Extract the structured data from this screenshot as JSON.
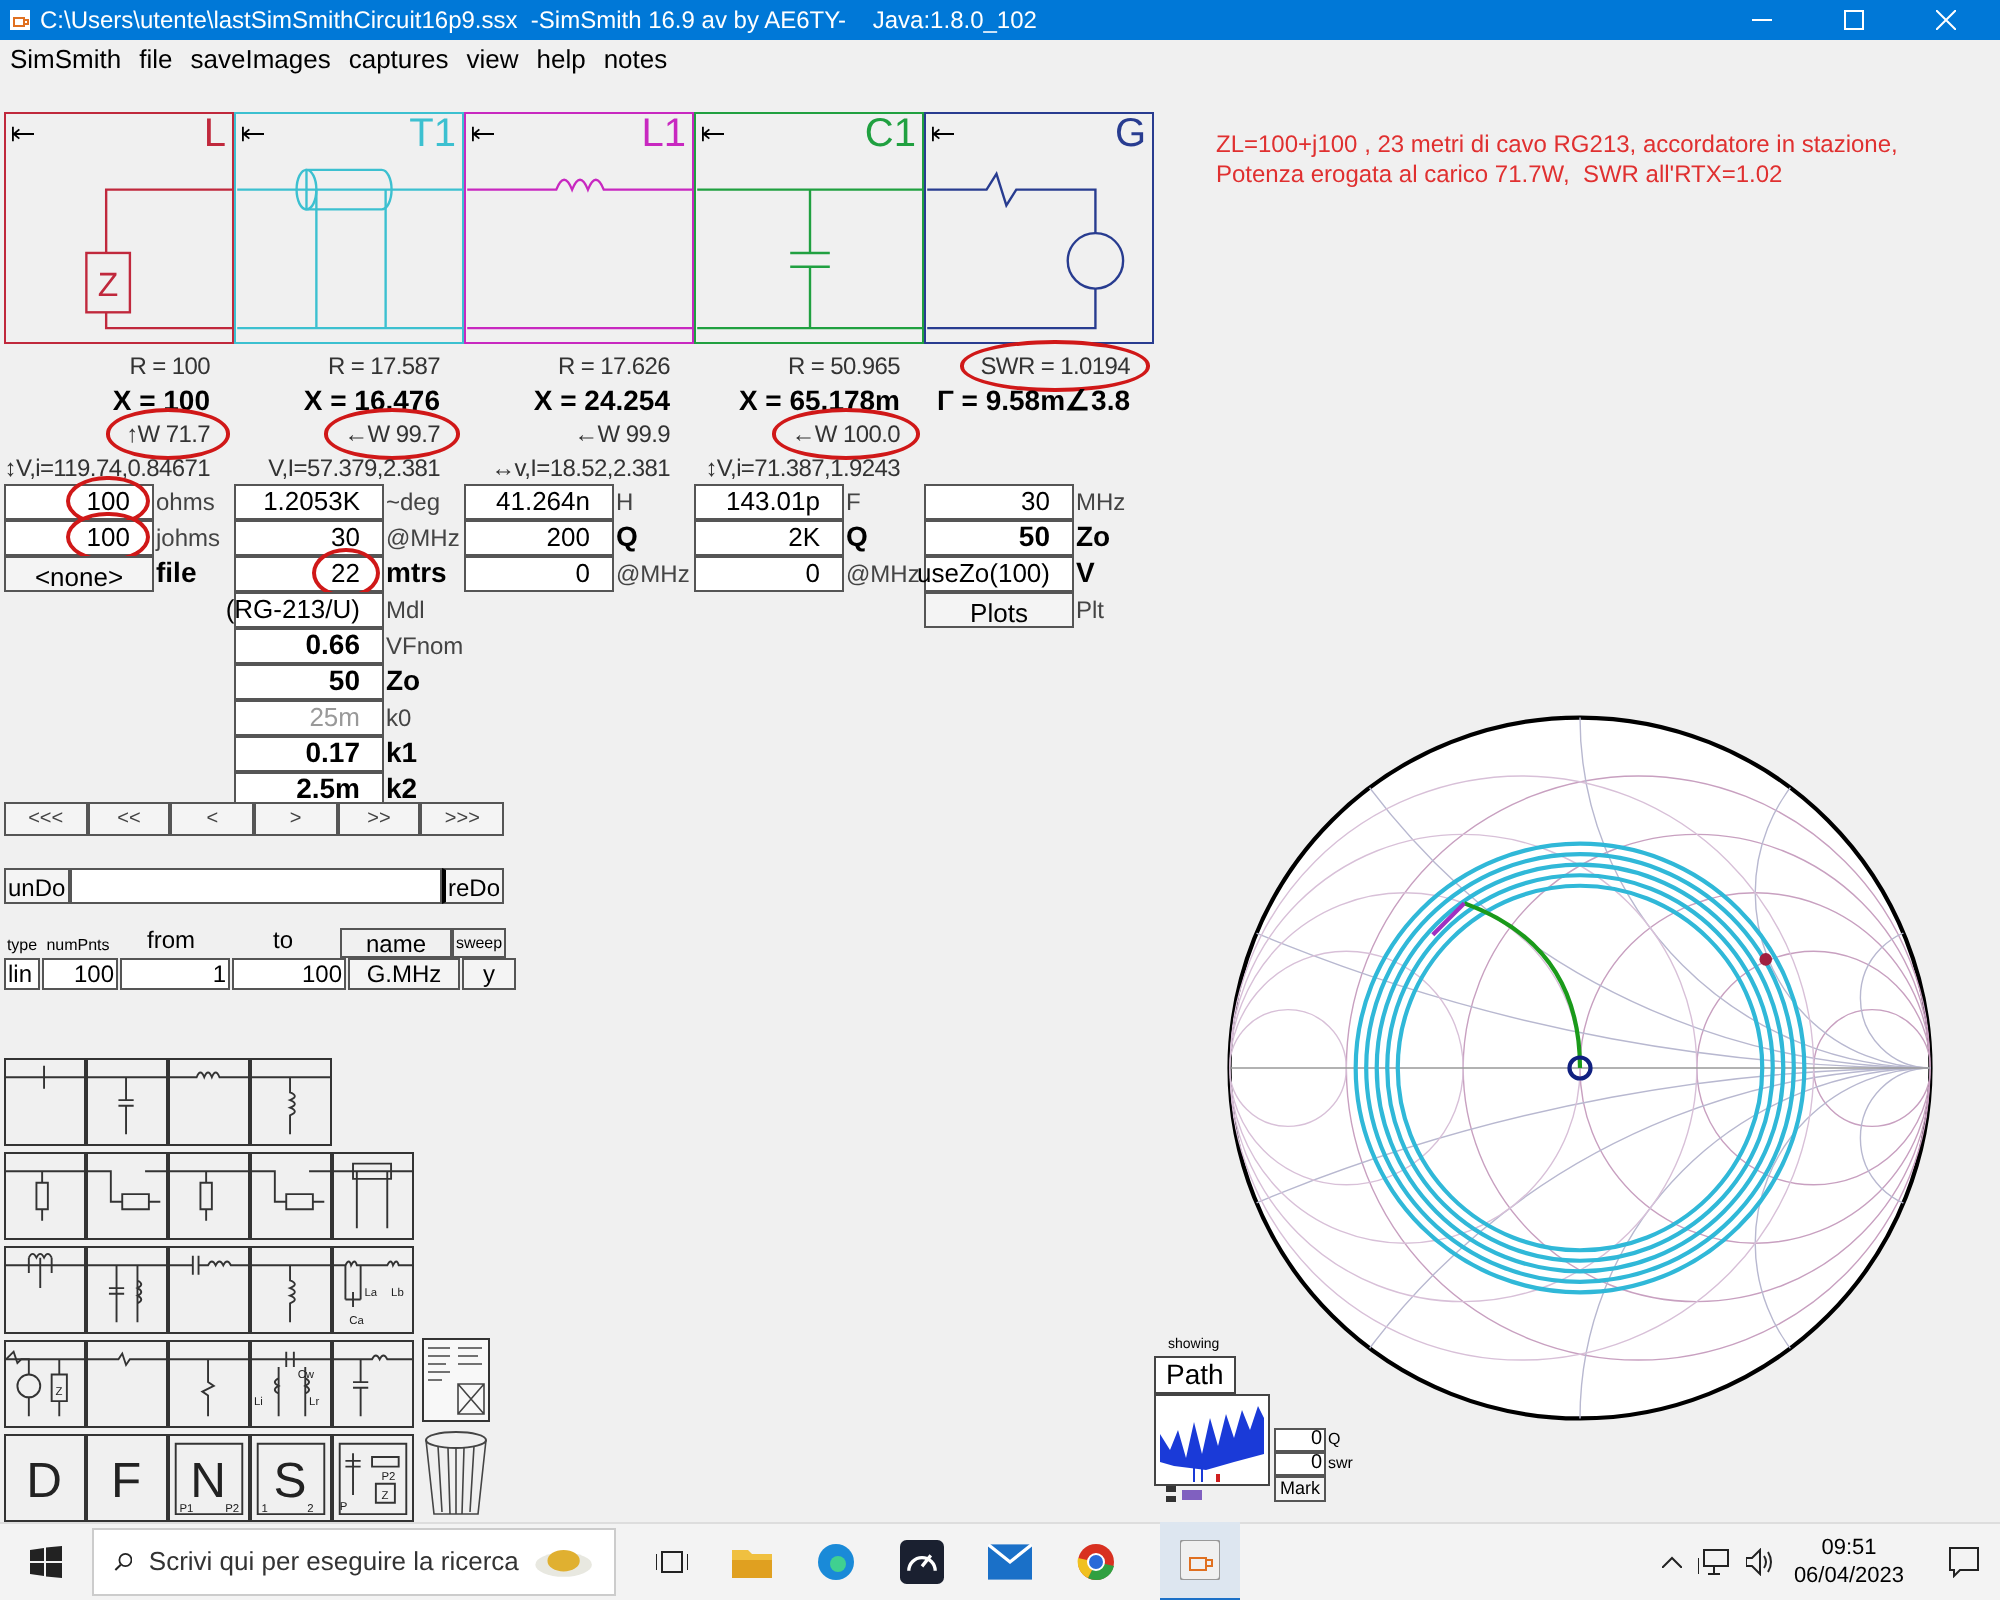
{
  "window": {
    "title": "C:\\Users\\utente\\lastSimSmithCircuit16p9.ssx  -SimSmith 16.9 av by AE6TY-    Java:1.8.0_102"
  },
  "menu": [
    "SimSmith",
    "file",
    "saveImages",
    "captures",
    "view",
    "help",
    "notes"
  ],
  "circuit": [
    {
      "label": "L",
      "kind": "load",
      "color": "#c0283c",
      "symbol": "Z",
      "readings": [
        {
          "text": "R = 100",
          "bold": false,
          "circled": false
        },
        {
          "text": "X = 100",
          "bold": true,
          "circled": false
        },
        {
          "text": "↑W 71.7",
          "bold": false,
          "circled": true
        },
        {
          "text": "↕V,i=119.74,0.84671",
          "bold": false,
          "circled": false
        }
      ],
      "fields": [
        {
          "value": "100",
          "unit": "ohms",
          "kind": "input",
          "value_bold": false,
          "unit_bold": false,
          "dim": false,
          "circled": true
        },
        {
          "value": "100",
          "unit": "johms",
          "kind": "input",
          "value_bold": false,
          "unit_bold": false,
          "dim": false,
          "circled": true
        },
        {
          "value": "<none>",
          "unit": "file",
          "kind": "button",
          "value_bold": false,
          "unit_bold": true,
          "dim": false,
          "circled": false
        }
      ]
    },
    {
      "label": "T1",
      "kind": "line",
      "color": "#3cc0d0",
      "readings": [
        {
          "text": "R = 17.587",
          "bold": false,
          "circled": false
        },
        {
          "text": "X = 16.476",
          "bold": true,
          "circled": false
        },
        {
          "text": "←W 99.7",
          "bold": false,
          "circled": true
        },
        {
          "text": "V,I=57.379,2.381",
          "bold": false,
          "circled": false
        }
      ],
      "fields": [
        {
          "value": "1.2053K",
          "unit": "~deg",
          "kind": "input",
          "value_bold": false,
          "unit_bold": false,
          "dim": false,
          "circled": false
        },
        {
          "value": "30",
          "unit": "@MHz",
          "kind": "input",
          "value_bold": false,
          "unit_bold": false,
          "dim": false,
          "circled": false
        },
        {
          "value": "22",
          "unit": "mtrs",
          "kind": "input",
          "value_bold": false,
          "unit_bold": true,
          "dim": false,
          "circled": true
        },
        {
          "value": "(RG-213/U)",
          "unit": "Mdl",
          "kind": "input",
          "value_bold": false,
          "unit_bold": false,
          "dim": false,
          "circled": false
        },
        {
          "value": "0.66",
          "unit": "VFnom",
          "kind": "input",
          "value_bold": true,
          "unit_bold": false,
          "dim": false,
          "circled": false
        },
        {
          "value": "50",
          "unit": "Zo",
          "kind": "input",
          "value_bold": true,
          "unit_bold": true,
          "dim": false,
          "circled": false
        },
        {
          "value": "25m",
          "unit": "k0",
          "kind": "input",
          "value_bold": false,
          "unit_bold": false,
          "dim": true,
          "circled": false
        },
        {
          "value": "0.17",
          "unit": "k1",
          "kind": "input",
          "value_bold": true,
          "unit_bold": true,
          "dim": false,
          "circled": false
        },
        {
          "value": "2.5m",
          "unit": "k2",
          "kind": "input",
          "value_bold": true,
          "unit_bold": true,
          "dim": false,
          "circled": false
        }
      ]
    },
    {
      "label": "L1",
      "kind": "series_l",
      "color": "#c828c0",
      "readings": [
        {
          "text": "R = 17.626",
          "bold": false,
          "circled": false
        },
        {
          "text": "X = 24.254",
          "bold": true,
          "circled": false
        },
        {
          "text": "←W 99.9",
          "bold": false,
          "circled": false
        },
        {
          "text": "↔v,I=18.52,2.381",
          "bold": false,
          "circled": false
        }
      ],
      "fields": [
        {
          "value": "41.264n",
          "unit": "H",
          "kind": "input",
          "value_bold": false,
          "unit_bold": false,
          "dim": false,
          "circled": false
        },
        {
          "value": "200",
          "unit": "Q",
          "kind": "input",
          "value_bold": false,
          "unit_bold": true,
          "dim": false,
          "circled": false
        },
        {
          "value": "0",
          "unit": "@MHz",
          "kind": "input",
          "value_bold": false,
          "unit_bold": false,
          "dim": false,
          "circled": false
        }
      ]
    },
    {
      "label": "C1",
      "kind": "shunt_c",
      "color": "#20a040",
      "readings": [
        {
          "text": "R = 50.965",
          "bold": false,
          "circled": false
        },
        {
          "text": "X = 65.178m",
          "bold": true,
          "circled": false
        },
        {
          "text": "←W 100.0",
          "bold": false,
          "circled": true
        },
        {
          "text": "↕V,i=71.387,1.9243",
          "bold": false,
          "circled": false
        }
      ],
      "fields": [
        {
          "value": "143.01p",
          "unit": "F",
          "kind": "input",
          "value_bold": false,
          "unit_bold": false,
          "dim": false,
          "circled": false
        },
        {
          "value": "2K",
          "unit": "Q",
          "kind": "input",
          "value_bold": false,
          "unit_bold": true,
          "dim": false,
          "circled": false
        },
        {
          "value": "0",
          "unit": "@MHz",
          "kind": "input",
          "value_bold": false,
          "unit_bold": false,
          "dim": false,
          "circled": false
        }
      ]
    },
    {
      "label": "G",
      "kind": "gen",
      "color": "#283c90",
      "readings": [
        {
          "text": "SWR = 1.0194",
          "bold": false,
          "circled": true
        },
        {
          "text": "Γ = 9.58m∠3.8",
          "bold": true,
          "circled": false
        }
      ],
      "fields": [
        {
          "value": "30",
          "unit": "MHz",
          "kind": "input",
          "value_bold": false,
          "unit_bold": false,
          "dim": false,
          "circled": false
        },
        {
          "value": "50",
          "unit": "Zo",
          "kind": "input",
          "value_bold": true,
          "unit_bold": true,
          "dim": false,
          "circled": false
        },
        {
          "value": "useZo(100)",
          "unit": "V",
          "kind": "input",
          "value_bold": false,
          "unit_bold": true,
          "dim": false,
          "circled": false
        },
        {
          "value": "Plots",
          "unit": "Plt",
          "kind": "button",
          "value_bold": false,
          "unit_bold": false,
          "dim": false,
          "circled": false
        }
      ]
    }
  ],
  "nav_buttons": [
    "<<<",
    "<<",
    "<",
    ">",
    ">>",
    ">>>"
  ],
  "undo": "unDo",
  "redo": "reDo",
  "sweep": {
    "headers": [
      {
        "text": "type",
        "boxed": false
      },
      {
        "text": "numPnts",
        "boxed": false
      },
      {
        "text": "from",
        "boxed": false
      },
      {
        "text": "to",
        "boxed": false
      },
      {
        "text": "name",
        "boxed": true
      },
      {
        "text": "sweep",
        "boxed": true
      }
    ],
    "values": [
      "lin",
      "100",
      "1",
      "100",
      "G.MHz",
      "y"
    ]
  },
  "palette": [
    [
      {
        "kind": "series_bar"
      },
      {
        "kind": "shunt_c"
      },
      {
        "kind": "series_l"
      },
      {
        "kind": "shunt_l"
      }
    ],
    [
      {
        "kind": "stub_shunt"
      },
      {
        "kind": "stub_series"
      },
      {
        "kind": "stub_shunt"
      },
      {
        "kind": "stub_series"
      },
      {
        "kind": "line"
      }
    ],
    [
      {
        "kind": "series_lc"
      },
      {
        "kind": "shunt_lc"
      },
      {
        "kind": "series_cl"
      },
      {
        "kind": "shunt_l"
      },
      {
        "kind": "transformer",
        "labels": [
          "La",
          "Lb",
          "Ca"
        ]
      }
    ],
    [
      {
        "kind": "gen",
        "labels": [
          "Z"
        ]
      },
      {
        "kind": "series_r"
      },
      {
        "kind": "shunt_r"
      },
      {
        "kind": "coupled",
        "labels": [
          "Cw",
          "Li",
          "Lr"
        ]
      },
      {
        "kind": "lpf"
      }
    ],
    [
      {
        "kind": "letter",
        "letter": "D"
      },
      {
        "kind": "letter",
        "letter": "F"
      },
      {
        "kind": "boxed_letter",
        "letter": "N",
        "labels": [
          "P1",
          "P2"
        ]
      },
      {
        "kind": "boxed_letter",
        "letter": "S",
        "labels": [
          "1",
          "2"
        ]
      },
      {
        "kind": "custom",
        "labels": [
          "P",
          "P2",
          "Z"
        ]
      }
    ]
  ],
  "note": [
    "ZL=100+j100 , 23 metri di cavo RG213, accordatore in stazione,",
    "Potenza erogata al carico 71.7W,  SWR all'RTX=1.02"
  ],
  "path_panel": {
    "caption": "showing",
    "mode": "Path",
    "fields": [
      {
        "value": "0",
        "unit": "Q"
      },
      {
        "value": "0",
        "unit": "swr"
      }
    ],
    "mark": "Mark"
  },
  "taskbar": {
    "search_placeholder": "Scrivi qui per eseguire la ricerca",
    "time": "09:51",
    "date": "06/04/2023"
  }
}
